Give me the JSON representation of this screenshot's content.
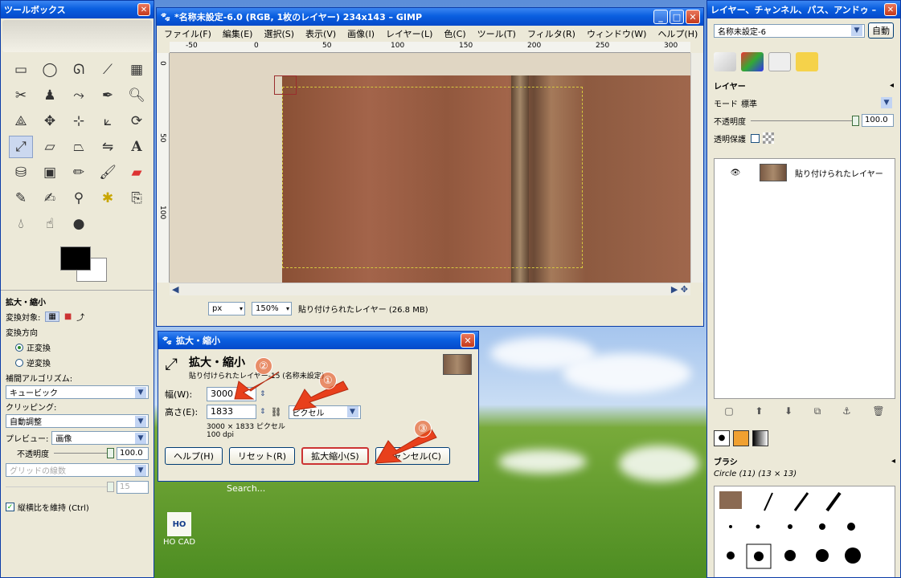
{
  "toolbox": {
    "title": "ツールボックス",
    "options_title": "拡大・縮小",
    "transform_label": "変換対象:",
    "direction_label": "変換方向",
    "direction_normal": "正変換",
    "direction_reverse": "逆変換",
    "interp_label": "補間アルゴリズム:",
    "interp_value": "キュービック",
    "clipping_label": "クリッピング:",
    "clipping_value": "自動調整",
    "preview_label": "プレビュー:",
    "preview_value": "画像",
    "opacity_label": "不透明度",
    "opacity_value": "100.0",
    "grid_label": "グリッドの線数",
    "grid_value": "15",
    "keep_aspect_label": "縦横比を維持 (Ctrl)"
  },
  "image_window": {
    "title": "*名称未設定-6.0 (RGB, 1枚のレイヤー) 234x143 – GIMP",
    "menus": [
      "ファイル(F)",
      "編集(E)",
      "選択(S)",
      "表示(V)",
      "画像(I)",
      "レイヤー(L)",
      "色(C)",
      "ツール(T)",
      "フィルタ(R)",
      "ウィンドウ(W)",
      "ヘルプ(H)"
    ],
    "ruler_h": [
      "-50",
      "0",
      "50",
      "100",
      "150",
      "200",
      "250",
      "300"
    ],
    "ruler_v": [
      "0",
      "50",
      "100"
    ],
    "unit": "px",
    "zoom": "150%",
    "status": "貼り付けられたレイヤー (26.8 MB)"
  },
  "layers_window": {
    "title": "レイヤー、チャンネル、パス、アンドゥ –",
    "image_name": "名称未設定-6",
    "auto_button": "自動",
    "layers_label": "レイヤー",
    "mode_label": "モード",
    "mode_value": "標準",
    "opacity_label": "不透明度",
    "opacity_value": "100.0",
    "lock_label": "透明保護",
    "layer_name": "貼り付けられたレイヤー",
    "brushes_label": "ブラシ",
    "brush_name": "Circle (11) (13 × 13)"
  },
  "scale_dialog": {
    "title": "拡大・縮小",
    "heading": "拡大・縮小",
    "subheading": "貼り付けられたレイヤー-15 (名称未設定)",
    "width_label": "幅(W):",
    "width_value": "3000",
    "height_label": "高さ(E):",
    "height_value": "1833",
    "unit_value": "ピクセル",
    "size_info": "3000 × 1833 ピクセル",
    "dpi_info": "100 dpi",
    "help_button": "ヘルプ(H)",
    "reset_button": "リセット(R)",
    "scale_button": "拡大縮小(S)",
    "cancel_button": "キャンセル(C)",
    "annotations": [
      "①",
      "②",
      "③"
    ]
  },
  "desktop": {
    "search_label": "Search...",
    "icon_label": "HO CAD"
  }
}
